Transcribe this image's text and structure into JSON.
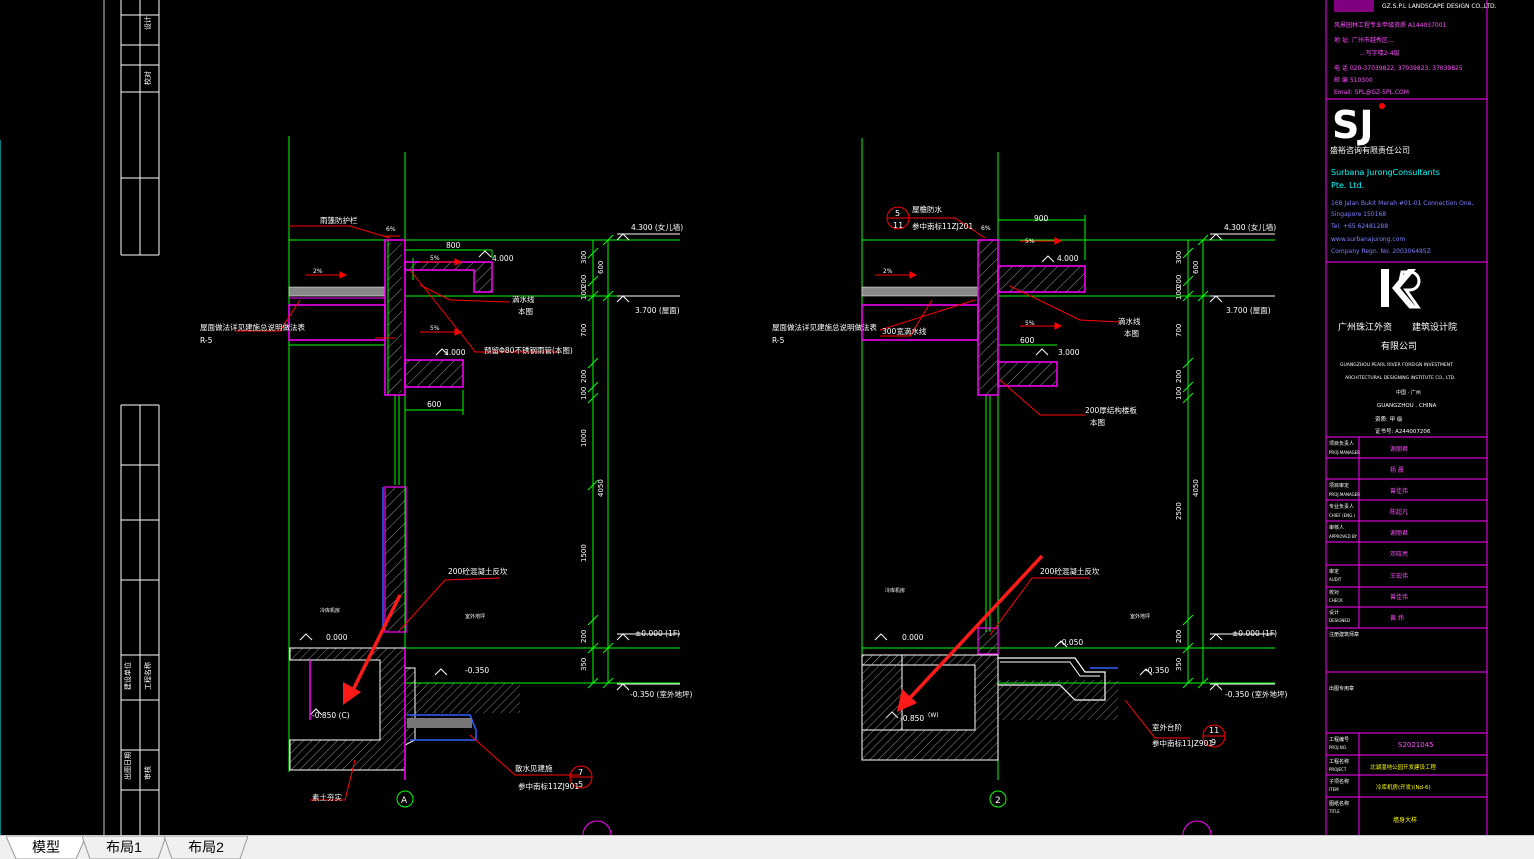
{
  "colors": {
    "background": "#000000",
    "green": "#00ff00",
    "magenta": "#ff00ff",
    "white": "#ffffff",
    "red": "#ff0000",
    "cyan": "#00ffff",
    "yellow": "#ffff00",
    "blue": "#3060ff",
    "markup_arrow": "#ff1a1a"
  },
  "tabs": [
    {
      "label": "模型",
      "active": true
    },
    {
      "label": "布局1",
      "active": false
    },
    {
      "label": "布局2",
      "active": false
    }
  ],
  "section_a": {
    "annot_top": "雨篷防护栏",
    "annot_slope_small": "6%",
    "annot_left_note": "屋面做法详见建施总说明做法表",
    "annot_r5": "R-5",
    "annot_drip": "滴水线",
    "annot_drip2": "本图",
    "annot_pipe": "预留Φ80不锈钢雨管(本图)",
    "dim_800": "800",
    "dim_600": "600",
    "slope_5a": "5%",
    "slope_5b": "5%",
    "slope_2": "2%",
    "lvl_4000": "4.000",
    "lvl_3000": "3.000",
    "lvl_4300": "4.300 (女儿墙)",
    "lvl_3700": "3.700 (屋面)",
    "lvl_000": "±0.000 (1F)",
    "lvl_m350": "-0.350 (室外地坪)",
    "lvl_m350b": "-0.350",
    "lvl_0000": "0.000",
    "lvl_m850": "-0.850 (C)",
    "vdims": [
      "300",
      "200",
      "100",
      "700",
      "200",
      "100",
      "1000",
      "1500",
      "200",
      "350"
    ],
    "vdim_600": "600",
    "vdim_4050": "4050",
    "annot_wall": "200砼混凝土反坎",
    "annot_bottom": "散水见建施",
    "annot_ref": "参中南标11ZJ901",
    "annot_soil": "素土夯实",
    "room_left": "冷库机房",
    "room_right": "室外地坪",
    "axis": "A",
    "callout_top": "7",
    "callout_bottom": "5"
  },
  "section_b": {
    "annot_top": "屋檐防水",
    "annot_ref_top": "参中南标11ZJ201",
    "callout_top": "5",
    "callout_bottom": "11",
    "annot_slope_small": "6%",
    "dim_900": "900",
    "dim_600": "600",
    "slope_5a": "5%",
    "slope_5b": "5%",
    "slope_2": "2%",
    "lvl_4000": "4.000",
    "lvl_3000": "3.000",
    "lvl_4300": "4.300 (女儿墙)",
    "lvl_3700": "3.700 (屋面)",
    "lvl_000": "±0.000 (1F)",
    "lvl_m350": "-0.350 (室外地坪)",
    "lvl_m350b": "-0.350",
    "lvl_m050": "-0.050",
    "lvl_0000": "0.000",
    "lvl_m850": "-0.850",
    "lvl_m850_tag": "(W)",
    "annot_left_note": "屋面做法详见建施总说明做法表",
    "annot_r5": "R-5",
    "annot_left2": "300宽滴水线",
    "annot_drip": "滴水线",
    "annot_drip2": "本图",
    "annot_beam": "200厚结构楼板",
    "annot_beam2": "本图",
    "annot_wall": "200砼混凝土反坎",
    "vdims": [
      "300",
      "200",
      "100",
      "700",
      "200",
      "100",
      "2500",
      "200",
      "350"
    ],
    "vdim_600": "600",
    "vdim_4050": "4050",
    "annot_step": "室外台阶",
    "annot_ref": "参中南标11JZ901",
    "step_callout_top": "11",
    "step_callout_bottom": "9",
    "room_left": "冷库机房",
    "room_right": "室外地坪",
    "axis": "2"
  },
  "title_block": {
    "firm1_name": "GZ.S.P.L LANDSCAPE DESIGN CO.,LTD.",
    "firm1_line1": "风景园林工程专业甲级资质 A144037001",
    "firm1_line2": "地 址: 广州市越秀区...",
    "firm1_line3": "...写字楼2-4层",
    "firm1_tel": "电 话 020-37039822, 37039823, 37039825",
    "firm1_post": "邮 编 510300",
    "firm1_email": "Email: SPL@GZ-SPL.COM",
    "sj_logo": "SJ",
    "sj_cn": "盛裕咨询有限责任公司",
    "sj_en1": "Surbana JurongConsultants",
    "sj_en2": "Pte. Ltd.",
    "sj_addr1": "168 Jalan Bukit Merah #01-01 Connection One,",
    "sj_addr2": "Singapore 150168",
    "sj_tel": "Tel: +65 62481288",
    "sj_web": "www.surbanajurong.com",
    "sj_reg": "Company Regn. No. 200306495Z",
    "inst_cn1": "广州珠江外资",
    "inst_cn2": "建筑设计院",
    "inst_cn3": "有限公司",
    "inst_en1": "GUANGZHOU PEARL RIVER FOREIGN INVESTMENT",
    "inst_en2": "ARCHITECTURAL DESIGNING INSTITUTE CO., LTD.",
    "inst_city_cn": "中国 · 广州",
    "inst_city_en": "GUANGZHOU . CHINA",
    "inst_cert": "资质: 甲 级",
    "inst_certno": "证书号: A244007206",
    "rows": [
      {
        "label": "项目负责人",
        "sub": "PROJ.MANAGER",
        "name": "谢丽君"
      },
      {
        "label": "",
        "sub": "",
        "name": "杨 晨"
      },
      {
        "label": "项目审定",
        "sub": "PROJ.MANAGER",
        "name": "曾佳伟"
      },
      {
        "label": "专业负责人",
        "sub": "CHIEF (ENG.)",
        "name": "陈超凡"
      },
      {
        "label": "审核人",
        "sub": "APPROVED BY",
        "name": "谢丽君"
      },
      {
        "label": "",
        "sub": "",
        "name": "邓晓亮"
      },
      {
        "label": "审定",
        "sub": "AUDIT",
        "name": "王宏伟"
      },
      {
        "label": "校对",
        "sub": "CHECK",
        "name": "曾佳伟"
      },
      {
        "label": "设计",
        "sub": "DESIGNED",
        "name": "黄 炜"
      }
    ],
    "seal_label": "注册建筑师章",
    "note_label": "出图专用章",
    "proj_no_label": "工程编号",
    "proj_no_sub": "PROJ.NO.",
    "proj_no": "S2021045",
    "proj_label": "工程名称",
    "proj_sub": "PROJECT",
    "proj_name": "北湖湿地公园开发建设工程",
    "item_label": "子项名称",
    "item_sub": "ITEM",
    "item_name": "冷库机房(开发)(Nd-6)",
    "title_label": "图纸名称",
    "title_sub": "TITLE",
    "title_name": "墙身大样"
  },
  "left_strip": {
    "labels": [
      "建设单位",
      "工程名称",
      "出图日期",
      "审核",
      "设计",
      "校对"
    ]
  }
}
